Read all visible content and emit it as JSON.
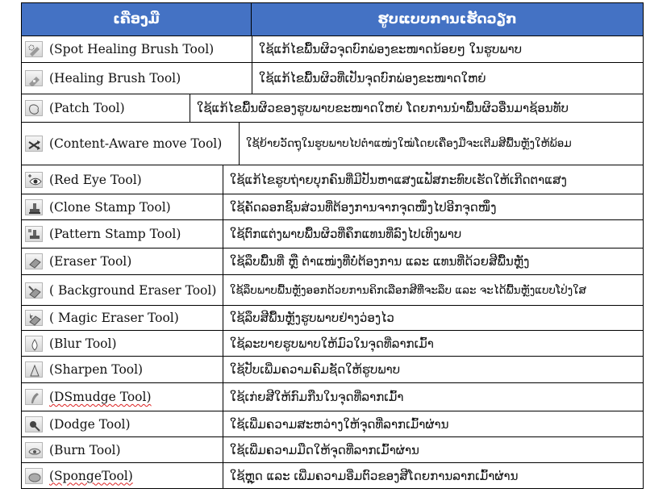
{
  "header": {
    "left": "ເຄື່ອງມື",
    "right": "ຮູບແບບການເຮັດວຽກ"
  },
  "rows": [
    {
      "tool": "(Spot Healing Brush Tool)",
      "desc": "ໃຊ້ແກ້ໄຂພື້ນຜິວຈຸດບົກພ່ອງຂະໜາດນ້ອຍໆ ໃນຮູບພາບ",
      "icon": "spot-healing-brush-icon"
    },
    {
      "tool": "(Healing Brush Tool)",
      "desc": "ໃຊ້ແກ້ໄຂພື້ນຜິວທີ່ເປັນຈຸດບົກພ່ອງຂະໜາດໃຫຍ່",
      "icon": "healing-brush-icon"
    },
    {
      "tool": "(Patch Tool)",
      "desc": "ໃຊ້ແກ້ໄຂພື້ນຜິວຂອງຮູບພາບຂະໜາດໃຫຍ່ ໂດຍການນຳພື້ນຜິວອື່ນມາຊ້ອນທັບ",
      "icon": "patch-icon"
    },
    {
      "tool": "(Content-Aware move Tool)",
      "desc": "ໃຊ້ຍ້າຍວັດຖຸໃນຮູບພາບໄປຕຳແໜ່ງໃໝ່ໂດຍເຄື່ອງມືຈະເຕີມສີພື້ນຫຼັງໃຫ້ພ້ອມ",
      "icon": "content-aware-move-icon"
    },
    {
      "tool": "(Red Eye Tool)",
      "desc": "ໃຊ້ແກ້ໄຂຮູບຖ່າຍບຸກຄົນທີ່ມີປັນຫາແສງແຟັສກະທົບເຮັດໃຫ້ເກີດຕາແສງ",
      "icon": "red-eye-icon"
    },
    {
      "tool": "(Clone Stamp Tool)",
      "desc": "ໃຊ້ຄັດລອກຊິ້ນສ່ວນທີ່ຕ້ອງການຈາກຈຸດໜຶ່ງໄປອີກຈຸດໜຶ່ງ",
      "icon": "clone-stamp-icon"
    },
    {
      "tool": "(Pattern Stamp Tool)",
      "desc": "ໃຊ້ຕົກແຕ່ງພາບພື້ນຜິວທີ່ຄຶກແທນທີ່ລົງໄປເທິງພາບ",
      "icon": "pattern-stamp-icon"
    },
    {
      "tool": "(Eraser Tool)",
      "desc": "ໃຊ້ລຶບພື້ນທີ່ ຫຼື ຕຳແໜ່ງທີ່ບໍ່ຕ້ອງການ ແລະ ແທນທີ່ດ້ວຍສີພື້ນຫຼັງ",
      "icon": "eraser-icon"
    },
    {
      "tool": "( Background Eraser Tool)",
      "desc": "ໃຊ້ລຶບພາບພື້ນຫຼັງອອກດ້ວຍການຄິກເລືອກສີທີ່ຈະລຶບ ແລະ ຈະໄດ້ພື້ນຫຼັງແບບໂປ່ງໃສ",
      "icon": "background-eraser-icon"
    },
    {
      "tool": "( Magic Eraser Tool)",
      "desc": "ໃຊ້ລຶບສີພື້ນຫຼັງຮູບພາບຢ່າງວ່ອງໄວ",
      "icon": "magic-eraser-icon"
    },
    {
      "tool": "(Blur Tool)",
      "desc": "ໃຊ້ລະບາຍຮູບພາບໃຫ້ມົວໃນຈຸດທີ່ລາກເມົ້າ",
      "icon": "blur-icon"
    },
    {
      "tool": "(Sharpen Tool)",
      "desc": "ໃຊ້ປັບເພີ່ມຄວາມຄົມຊັດໃຫ້ຮູບພາບ",
      "icon": "sharpen-icon"
    },
    {
      "tool": "(DSmudge Tool)",
      "desc": "ໃຊ້ເກ່ຍສີໃຫ້ກົມກືນໃນຈຸດທີ່ລາກເມົ້າ",
      "icon": "smudge-icon"
    },
    {
      "tool": "(Dodge Tool)",
      "desc": "ໃຊ້ເພີ່ມຄວາມສະຫວ່າງໃຫ້ຈຸດທີ່ລາກເມົ້າຜ່ານ",
      "icon": "dodge-icon"
    },
    {
      "tool": "(Burn Tool)",
      "desc": "ໃຊ້ເພີ່ມຄວາມມືດໃຫ້ຈຸດທີ່ລາກເມົ້າຜ່ານ",
      "icon": "burn-icon"
    },
    {
      "tool": "(SpongeTool)",
      "desc": "ໃຊ້ຫຼຸດ ແລະ ເພີ່ມຄວາມອີ່ມຕົວຂອງສີໂດຍການລາກເມົ້າຜ່ານ",
      "icon": "sponge-icon"
    }
  ]
}
